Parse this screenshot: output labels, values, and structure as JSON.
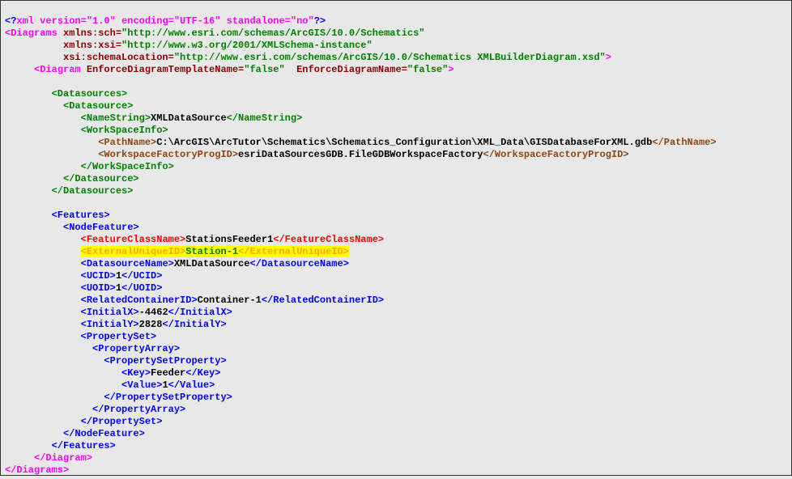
{
  "xml_declaration": {
    "prefix": "<?",
    "name": "xml",
    "attrs": "version=\"1.0\" encoding=\"UTF-16\" standalone=\"no\"",
    "suffix": "?>"
  },
  "lines": {
    "l1_open": "<Diagrams",
    "l1_attr1": " xmlns:sch=",
    "l1_val1": "\"http://www.esri.com/schemas/ArcGIS/10.0/Schematics\"",
    "l2_attr": "          xmlns:xsi=",
    "l2_val": "\"http://www.w3.org/2001/XMLSchema-instance\"",
    "l3_attr": "          xsi:schemaLocation=",
    "l3_val": "\"http://www.esri.com/schemas/ArcGIS/10.0/Schematics XMLBuilderDiagram.xsd\"",
    "l3_close": ">",
    "l4_indent": "     ",
    "l4_open": "<Diagram",
    "l4_attr1": " EnforceDiagramTemplateName=",
    "l4_val1": "\"false\"",
    "l4_attr2": "  EnforceDiagramName=",
    "l4_val2": "\"false\"",
    "l4_close": ">",
    "datasources_open": "        <Datasources>",
    "datasource_open": "          <Datasource>",
    "namestring_open": "             <NameString>",
    "namestring_val": "XMLDataSource",
    "namestring_close": "</NameString>",
    "workspaceinfo_open": "             <WorkSpaceInfo>",
    "pathname_indent": "                ",
    "pathname_open": "<PathName>",
    "pathname_val": "C:\\ArcGIS\\ArcTutor\\Schematics\\Schematics_Configuration\\XML_Data\\GISDatabaseForXML.gdb",
    "pathname_close": "</PathName>",
    "wfprogid_open": "<WorkspaceFactoryProgID>",
    "wfprogid_val": "esriDataSourcesGDB.FileGDBWorkspaceFactory",
    "wfprogid_close": "</WorkspaceFactoryProgID>",
    "workspaceinfo_close": "             </WorkSpaceInfo>",
    "datasource_close": "          </Datasource>",
    "datasources_close": "        </Datasources>",
    "features_open": "        <Features>",
    "nodefeature_open": "          <NodeFeature>",
    "fcn_indent": "             ",
    "fcn_open": "<FeatureClassName>",
    "fcn_val": "StationsFeeder1",
    "fcn_close": "</FeatureClassName>",
    "ext_indent": "             ",
    "ext_open": "<ExternalUniqueID>",
    "ext_val": "Station-1",
    "ext_close": "</ExternalUniqueID>",
    "dsn_open": "<DatasourceName>",
    "dsn_val": "XMLDataSource",
    "dsn_close": "</DatasourceName>",
    "ucid_open": "<UCID>",
    "ucid_val": "1",
    "ucid_close": "</UCID>",
    "uoid_open": "<UOID>",
    "uoid_val": "1",
    "uoid_close": "</UOID>",
    "relc_open": "<RelatedContainerID>",
    "relc_val": "Container-1",
    "relc_close": "</RelatedContainerID>",
    "initx_open": "<InitialX>",
    "initx_val": "-4462",
    "initx_close": "</InitialX>",
    "inity_open": "<InitialY>",
    "inity_val": "2828",
    "inity_close": "</InitialY>",
    "propset_open": "             <PropertySet>",
    "proparr_open": "               <PropertyArray>",
    "psp_open": "                 <PropertySetProperty>",
    "key_indent": "                    ",
    "key_open": "<Key>",
    "key_val": "Feeder",
    "key_close": "</Key>",
    "val_open": "<Value>",
    "val_val": "1",
    "val_close": "</Value>",
    "psp_close": "                 </PropertySetProperty>",
    "proparr_close": "               </PropertyArray>",
    "propset_close": "             </PropertySet>",
    "nodefeature_close": "          </NodeFeature>",
    "features_close": "        </Features>",
    "diagram_close": "     </Diagram>",
    "diagrams_close": "</Diagrams>"
  }
}
